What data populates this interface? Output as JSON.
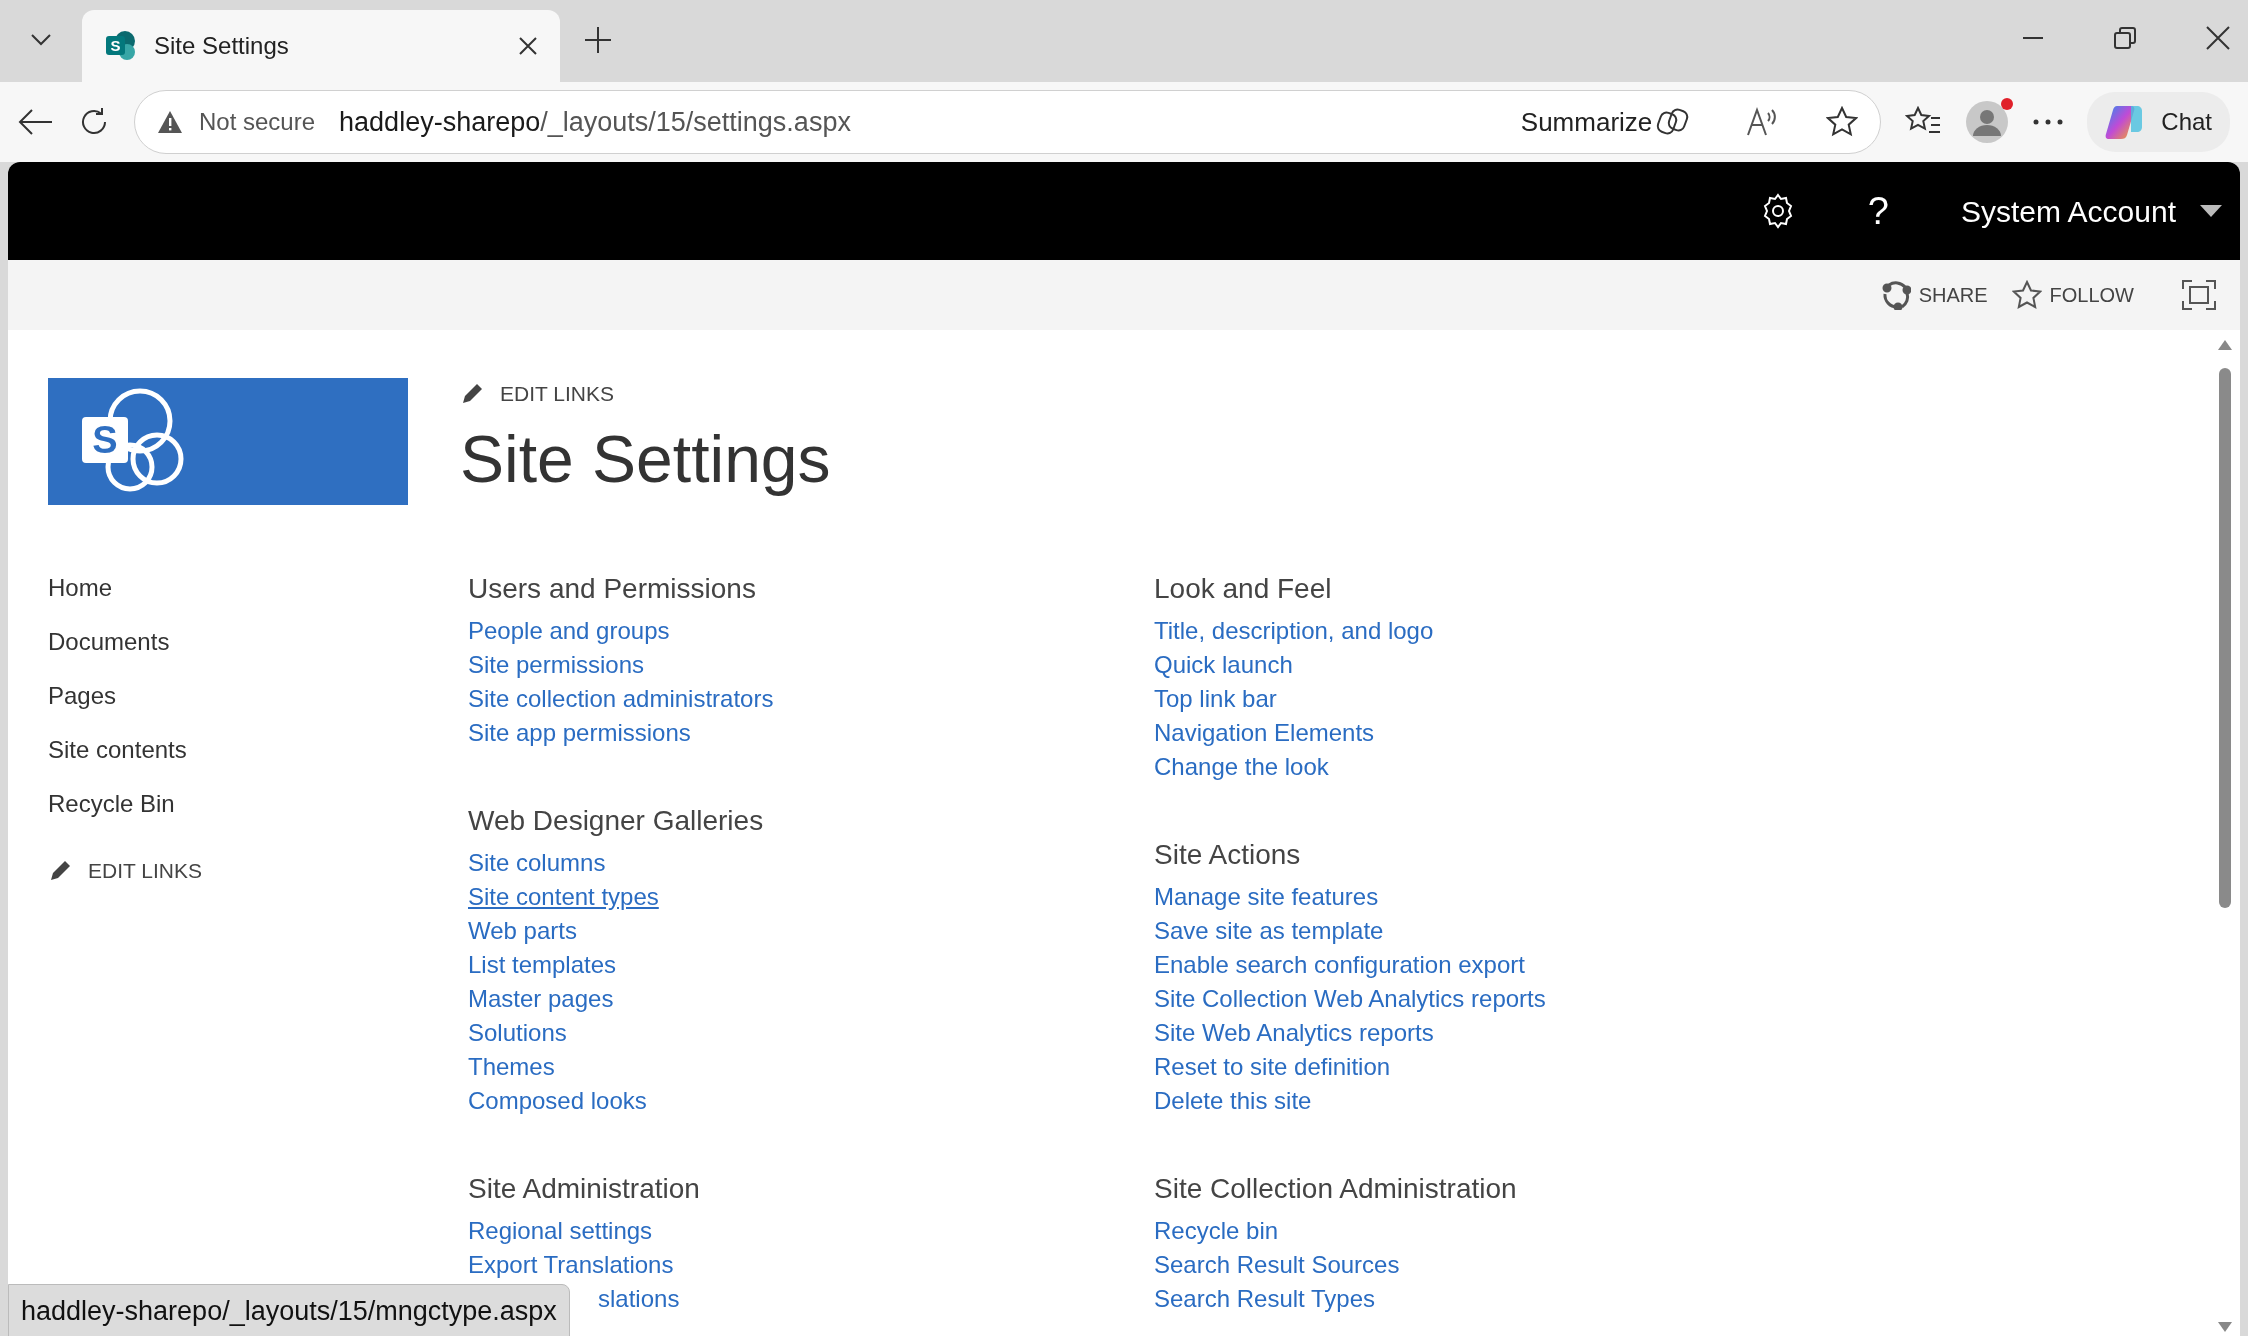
{
  "browser": {
    "tab": {
      "title": "Site Settings",
      "icon_letter": "S"
    },
    "address": {
      "security": "Not secure",
      "host": "haddley-sharepo",
      "path": "/_layouts/15/settings.aspx"
    },
    "summarize": "Summarize",
    "chat": "Chat"
  },
  "suite_bar": {
    "help": "?",
    "user": "System Account"
  },
  "ribbon": {
    "share": "SHARE",
    "follow": "FOLLOW"
  },
  "site": {
    "logo_letter": "S",
    "edit_links": "EDIT LINKS",
    "title": "Site Settings"
  },
  "left_nav": {
    "items": [
      "Home",
      "Documents",
      "Pages",
      "Site contents",
      "Recycle Bin"
    ],
    "edit_links": "EDIT LINKS"
  },
  "columns": [
    [
      {
        "heading": "Users and Permissions",
        "links": [
          {
            "text": "People and groups",
            "hovered": false
          },
          {
            "text": "Site permissions",
            "hovered": false
          },
          {
            "text": "Site collection administrators",
            "hovered": false
          },
          {
            "text": "Site app permissions",
            "hovered": false
          }
        ]
      },
      {
        "heading": "Web Designer Galleries",
        "links": [
          {
            "text": "Site columns",
            "hovered": false
          },
          {
            "text": "Site content types",
            "hovered": true
          },
          {
            "text": "Web parts",
            "hovered": false
          },
          {
            "text": "List templates",
            "hovered": false
          },
          {
            "text": "Master pages",
            "hovered": false
          },
          {
            "text": "Solutions",
            "hovered": false
          },
          {
            "text": "Themes",
            "hovered": false
          },
          {
            "text": "Composed looks",
            "hovered": false
          }
        ]
      },
      {
        "heading": "Site Administration",
        "links": [
          {
            "text": "Regional settings",
            "hovered": false,
            "kind": "link"
          },
          {
            "text": "Export Translations",
            "hovered": false,
            "kind": "link"
          },
          {
            "text": "slations",
            "hovered": false,
            "kind": "covered"
          }
        ]
      }
    ],
    [
      {
        "heading": "Look and Feel",
        "links": [
          {
            "text": "Title, description, and logo",
            "hovered": false
          },
          {
            "text": "Quick launch",
            "hovered": false
          },
          {
            "text": "Top link bar",
            "hovered": false
          },
          {
            "text": "Navigation Elements",
            "hovered": false
          },
          {
            "text": "Change the look",
            "hovered": false
          }
        ]
      },
      {
        "heading": "Site Actions",
        "links": [
          {
            "text": "Manage site features",
            "hovered": false
          },
          {
            "text": "Save site as template",
            "hovered": false
          },
          {
            "text": "Enable search configuration export",
            "hovered": false
          },
          {
            "text": "Site Collection Web Analytics reports",
            "hovered": false
          },
          {
            "text": "Site Web Analytics reports",
            "hovered": false
          },
          {
            "text": "Reset to site definition",
            "hovered": false
          },
          {
            "text": "Delete this site",
            "hovered": false
          }
        ]
      },
      {
        "heading": "Site Collection Administration",
        "links": [
          {
            "text": "Recycle bin",
            "hovered": false
          },
          {
            "text": "Search Result Sources",
            "hovered": false
          },
          {
            "text": "Search Result Types",
            "hovered": false
          }
        ]
      }
    ]
  ],
  "status_tooltip": "haddley-sharepo/_layouts/15/mngctype.aspx"
}
